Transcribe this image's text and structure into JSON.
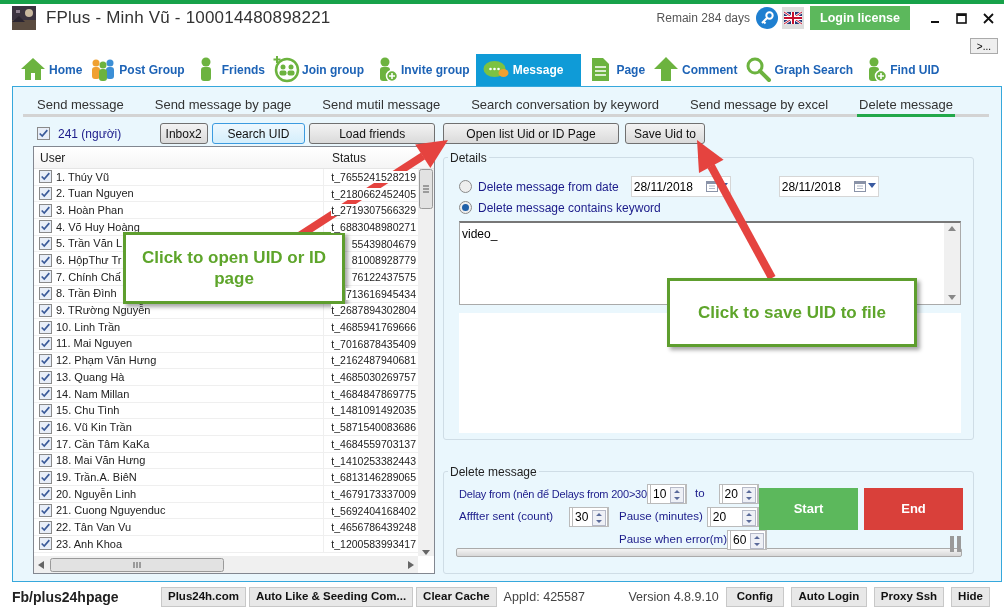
{
  "window": {
    "title": "FPlus - Minh Vũ - 100014480898221",
    "remain": "Remain 284 days",
    "login_button": "Login license",
    "more_button": ">..."
  },
  "toolbar": [
    {
      "label": "Home",
      "kind": "home",
      "selected": false
    },
    {
      "label": "Post Group",
      "kind": "group",
      "selected": false
    },
    {
      "label": "Friends",
      "kind": "person",
      "selected": false
    },
    {
      "label": "Join group",
      "kind": "join",
      "selected": false
    },
    {
      "label": "Invite group",
      "kind": "add_person",
      "selected": false
    },
    {
      "label": "Message",
      "kind": "message",
      "selected": true
    },
    {
      "label": "Page",
      "kind": "page",
      "selected": false
    },
    {
      "label": "Comment",
      "kind": "up",
      "selected": false
    },
    {
      "label": "Graph Search",
      "kind": "search",
      "selected": false
    },
    {
      "label": "Find UID",
      "kind": "add_person",
      "selected": false
    }
  ],
  "subtabs": [
    {
      "label": "Send message",
      "selected": false
    },
    {
      "label": "Send message by page",
      "selected": false
    },
    {
      "label": "Send mutil message",
      "selected": false
    },
    {
      "label": "Search conversation by keyword",
      "selected": false
    },
    {
      "label": "Send message by excel",
      "selected": false
    },
    {
      "label": "Delete message",
      "selected": true
    }
  ],
  "friends": {
    "select_all": {
      "label": "241 (người)",
      "checked": true
    },
    "buttons": [
      {
        "label": "Inbox2",
        "selected": false
      },
      {
        "label": "Search UID",
        "selected": true
      },
      {
        "label": "Load friends",
        "selected": false
      }
    ],
    "columns": [
      "User",
      "Status"
    ],
    "rows": [
      {
        "user": "1. Thúy Vũ",
        "status": "t_7655241528219",
        "checked": true
      },
      {
        "user": "2. Tuan Nguyen",
        "status": "t_2180662452405",
        "checked": true
      },
      {
        "user": "3. Hoàn Phan",
        "status": "t_2719307566329",
        "checked": true
      },
      {
        "user": "4. Võ Huy Hoàng",
        "status": "t_6883048980271",
        "checked": true
      },
      {
        "user": "5. Trần Văn L",
        "status": "55439804679",
        "checked": true
      },
      {
        "user": "6. HộpThư Tr",
        "status": "81008928779",
        "checked": true
      },
      {
        "user": "7. Chính Chấ",
        "status": "76122437575",
        "checked": true
      },
      {
        "user": "8. Trần Đình",
        "status": "713616945434",
        "checked": true
      },
      {
        "user": "9. TRường Nguyễn",
        "status": "t_2687894302804",
        "checked": true
      },
      {
        "user": "10. Linh Trần",
        "status": "t_4685941769666",
        "checked": true
      },
      {
        "user": "11. Mai Nguyen",
        "status": "t_7016878435409",
        "checked": true
      },
      {
        "user": "12. Phạm Văn Hưng",
        "status": "t_2162487940681",
        "checked": true
      },
      {
        "user": "13. Quang Hà",
        "status": "t_4685030269757",
        "checked": true
      },
      {
        "user": "14. Nam Millan",
        "status": "t_4684847869775",
        "checked": true
      },
      {
        "user": "15. Chu Tình",
        "status": "t_1481091492035",
        "checked": true
      },
      {
        "user": "16. Vũ Kin Trần",
        "status": "t_5871540083686",
        "checked": true
      },
      {
        "user": "17. Cần Tâm KaKa",
        "status": "t_4684559703137",
        "checked": true
      },
      {
        "user": "18. Mai Văn Hưng",
        "status": "t_1410253382443",
        "checked": true
      },
      {
        "user": "19. Trần.A. BiêN",
        "status": "t_6813146289065",
        "checked": true
      },
      {
        "user": "20. Nguyễn Linh",
        "status": "t_4679173337009",
        "checked": true
      },
      {
        "user": "21. Cuong Nguyenduc",
        "status": "t_5692404168402",
        "checked": true
      },
      {
        "user": "22. Tân Van Vu",
        "status": "t_4656786439248",
        "checked": true
      },
      {
        "user": "23. Anh Khoa",
        "status": "t_1200583993417",
        "checked": true
      }
    ]
  },
  "details": {
    "buttons": [
      {
        "label": "Open list Uid or ID Page",
        "selected": false
      },
      {
        "label": "Save Uid to",
        "selected": false
      }
    ],
    "title": "Details",
    "options": [
      {
        "label": "Delete message from date",
        "selected": false
      },
      {
        "label": "Delete message contains keyword",
        "selected": true
      }
    ],
    "date_from": "28/11/2018",
    "date_to": "28/11/2018",
    "keyword": "video_"
  },
  "delete": {
    "title": "Delete message",
    "delay_label": "Delay from (nên để Delays from 200>30",
    "delay_from": "10",
    "to_label": "to",
    "delay_to": "20",
    "after_label": "Afffter sent (count)",
    "after": "30",
    "pause_label": "Pause (minutes)",
    "pause": "20",
    "error_label": "Pause when error(m)",
    "error": "60",
    "start": "Start",
    "end": "End",
    "progress": {
      "level": 0
    }
  },
  "status_bar": {
    "link": "Fb/plus24hpage",
    "buttons_left": [
      "Plus24h.com",
      "Auto Like & Seeding Com...",
      "Clear Cache"
    ],
    "app_id": "AppId: 425587",
    "version": "Version 4.8.9.10",
    "buttons_right": [
      "Config",
      "Auto Login",
      "Proxy Ssh",
      "Hide"
    ]
  },
  "callouts": [
    {
      "text": "Click to open UID or ID page"
    },
    {
      "text": "Click to save UID to file"
    }
  ]
}
